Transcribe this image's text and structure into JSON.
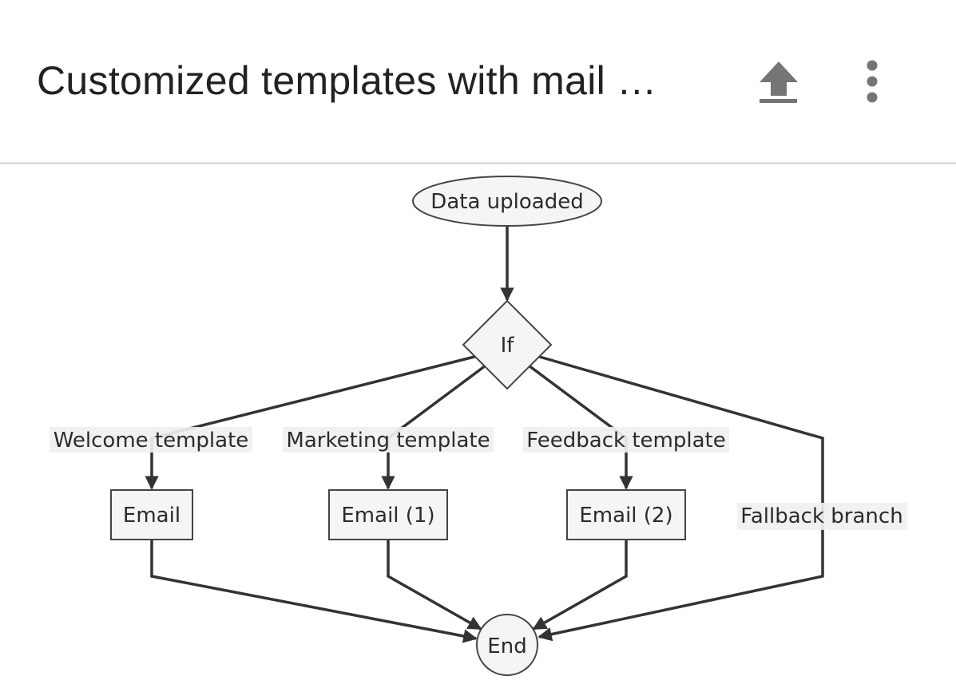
{
  "header": {
    "title": "Customized templates with mail …",
    "upload_icon": "upload-icon",
    "more_icon": "more-vert-icon"
  },
  "diagram": {
    "nodes": {
      "start": {
        "label": "Data uploaded",
        "shape": "ellipse"
      },
      "decision": {
        "label": "If",
        "shape": "diamond"
      },
      "email": {
        "label": "Email",
        "shape": "rect"
      },
      "email1": {
        "label": "Email (1)",
        "shape": "rect"
      },
      "email2": {
        "label": "Email (2)",
        "shape": "rect"
      },
      "end": {
        "label": "End",
        "shape": "circle"
      }
    },
    "edge_labels": {
      "welcome": "Welcome template",
      "marketing": "Marketing template",
      "feedback": "Feedback template",
      "fallback": "Fallback branch"
    },
    "edges": [
      {
        "from": "start",
        "to": "decision",
        "label": ""
      },
      {
        "from": "decision",
        "to": "email",
        "label": "Welcome template"
      },
      {
        "from": "decision",
        "to": "email1",
        "label": "Marketing template"
      },
      {
        "from": "decision",
        "to": "email2",
        "label": "Feedback template"
      },
      {
        "from": "decision",
        "to": "end",
        "label": "Fallback branch"
      },
      {
        "from": "email",
        "to": "end",
        "label": ""
      },
      {
        "from": "email1",
        "to": "end",
        "label": ""
      },
      {
        "from": "email2",
        "to": "end",
        "label": ""
      }
    ]
  }
}
